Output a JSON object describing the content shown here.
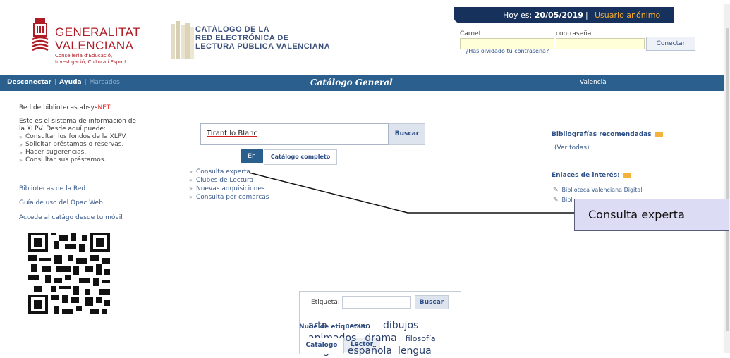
{
  "header": {
    "gv_logo": {
      "line1": "GENERALITAT",
      "line2": "VALENCIANA",
      "sub1": "Conselleria d'Educació,",
      "sub2": "Investigació, Cultura i Esport"
    },
    "catalog_logo": {
      "line1": "CATÁLOGO DE LA",
      "line2": "RED ELECTRÓNICA DE",
      "line3": "LECTURA PÚBLICA VALENCIANA"
    },
    "date_prefix": "Hoy es:",
    "date": "20/05/2019",
    "separator": "|",
    "user": "Usuario anónimo",
    "login": {
      "carnet_label": "Carnet",
      "password_label": "contraseña",
      "carnet_value": "",
      "password_value": "",
      "connect_label": "Conectar",
      "forgot_label": "¿Has olvidado tu contraseña?"
    }
  },
  "nav": {
    "disconnect": "Desconectar",
    "help": "Ayuda",
    "bookmarks": "Marcados",
    "sep": "|",
    "title": "Catálogo General",
    "language": "Valencià"
  },
  "left": {
    "network_prefix": "Red de bibliotecas absys",
    "network_suffix": "NET",
    "intro": "Este es el sistema de información de la XLPV. Desde aquí puede:",
    "items": [
      "Consultar los fondos de la XLPV.",
      "Solicitar préstamos o reservas.",
      "Hacer sugerencias.",
      "Consultar sus préstamos."
    ],
    "links": [
      "Bibliotecas de la Red",
      "Guía de uso del Opac Web",
      "Accede al catágo desde tu móvil"
    ]
  },
  "search": {
    "value": "Tirant lo Blanc",
    "button": "Buscar",
    "scope_en": "En",
    "scope_catalog": "Catálogo completo",
    "links": [
      "Consulta experta",
      "Clubes de Lectura",
      "Nuevas adquisiciones",
      "Consulta por comarcas"
    ]
  },
  "right": {
    "biblio_title": "Bibliografías recomendadas",
    "biblio_all": "(Ver todas)",
    "links_title": "Enlaces de interés:",
    "links": [
      "Biblioteca Valenciana Digital",
      "Bibl"
    ]
  },
  "callout": {
    "text": "Consulta experta"
  },
  "tags": {
    "title": "Nube de etiquetas:",
    "tabs": [
      "Catálogo",
      "Lector"
    ],
    "label": "Etiqueta:",
    "value": "",
    "button": "Buscar",
    "cloud": [
      {
        "text": "arte",
        "size": 13
      },
      {
        "text": "cocina",
        "size": 11
      },
      {
        "text": "dibujos",
        "size": 14
      },
      {
        "text": "animados",
        "size": 14
      },
      {
        "text": "drama",
        "size": 14
      },
      {
        "text": "filosofía",
        "size": 11
      },
      {
        "text": "lengua",
        "size": 14
      },
      {
        "text": "española",
        "size": 14
      },
      {
        "text": "lengua",
        "size": 14
      }
    ]
  }
}
